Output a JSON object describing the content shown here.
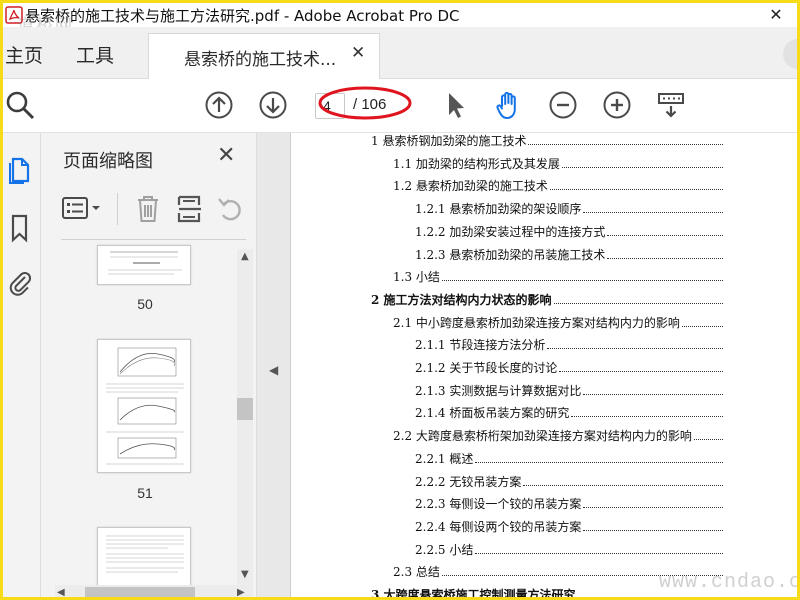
{
  "window": {
    "title": "悬索桥的施工技术与施工方法研究.pdf - Adobe Acrobat Pro DC",
    "close_glyph": "✕",
    "watermark_top": "道桥网"
  },
  "tabs": {
    "home": "主页",
    "tools": "工具",
    "document": "悬索桥的施工技术...",
    "close_glyph": "✕"
  },
  "toolbar": {
    "page_current": "4",
    "page_total": "/ 106",
    "icons": [
      "search-icon",
      "previous-page-icon",
      "next-page-icon",
      "select-cursor-icon",
      "hand-tool-icon",
      "zoom-out-icon",
      "zoom-in-icon",
      "more-tools-icon"
    ],
    "accent_color": "#1473e6",
    "highlight_color": "#e0141e"
  },
  "left_rail": {
    "icons": [
      "page-thumbnails-icon",
      "bookmark-icon",
      "attachment-icon"
    ]
  },
  "thumbnail_panel": {
    "title": "页面缩略图",
    "close_glyph": "✕",
    "tool_icons": [
      "options-menu-icon",
      "delete-page-icon",
      "extract-page-icon",
      "undo-icon"
    ],
    "thumbnails": [
      {
        "label": "50"
      },
      {
        "label": "51"
      },
      {
        "label": ""
      }
    ]
  },
  "document": {
    "toc": [
      {
        "text": "1  悬索桥钢加劲梁的施工技术",
        "level": 0
      },
      {
        "text": "1.1  加劲梁的结构形式及其发展",
        "level": 1
      },
      {
        "text": "1.2  悬索桥加劲梁的施工技术",
        "level": 1
      },
      {
        "text": "1.2.1  悬索桥加劲梁的架设顺序",
        "level": 2
      },
      {
        "text": "1.2.2  加劲梁安装过程中的连接方式",
        "level": 2
      },
      {
        "text": "1.2.3  悬索桥加劲梁的吊装施工技术",
        "level": 2
      },
      {
        "text": "1.3  小结",
        "level": 1
      },
      {
        "text": "2  施工方法对结构内力状态的影响",
        "level": 0,
        "bold": true
      },
      {
        "text": "2.1  中小跨度悬索桥加劲梁连接方案对结构内力的影响",
        "level": 1
      },
      {
        "text": "2.1.1  节段连接方法分析",
        "level": 2
      },
      {
        "text": "2.1.2  关于节段长度的讨论",
        "level": 2
      },
      {
        "text": "2.1.3  实测数据与计算数据对比",
        "level": 2
      },
      {
        "text": "2.1.4  桥面板吊装方案的研究",
        "level": 2
      },
      {
        "text": "2.2  大跨度悬索桥桁架加劲梁连接方案对结构内力的影响",
        "level": 1
      },
      {
        "text": "2.2.1  概述",
        "level": 2
      },
      {
        "text": "2.2.2  无铰吊装方案",
        "level": 2
      },
      {
        "text": "2.2.3  每侧设一个铰的吊装方案",
        "level": 2
      },
      {
        "text": "2.2.4  每侧设两个铰的吊装方案",
        "level": 2
      },
      {
        "text": "2.2.5  小结",
        "level": 2
      },
      {
        "text": "2.3  总结",
        "level": 1
      },
      {
        "text": "3  大跨度悬索桥施工控制测量方法研究",
        "level": 0,
        "bold": true
      }
    ]
  },
  "watermark_bottom": "www.cndao.com"
}
